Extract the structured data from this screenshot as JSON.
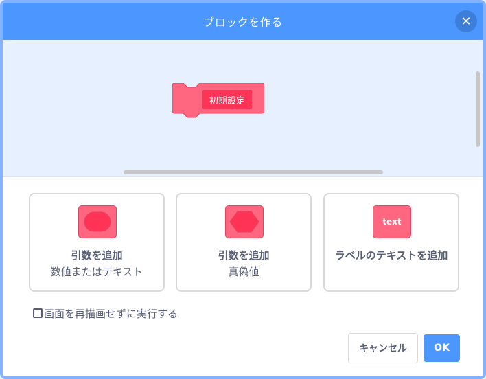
{
  "dialog": {
    "title": "ブロックを作る",
    "close_glyph": "✕"
  },
  "workspace": {
    "block_label": "初期設定",
    "block_color": "#ff6680",
    "label_bg_color": "#ff3355"
  },
  "options": [
    {
      "title": "引数を追加",
      "subtitle": "数値またはテキスト",
      "icon": "rounded-input-icon"
    },
    {
      "title": "引数を追加",
      "subtitle": "真偽値",
      "icon": "boolean-input-icon"
    },
    {
      "title": "ラベルのテキストを追加",
      "subtitle": "",
      "icon": "text-label-icon",
      "icon_text": "text"
    }
  ],
  "checkbox": {
    "label": "画面を再描画せずに実行する",
    "checked": false
  },
  "buttons": {
    "cancel": "キャンセル",
    "ok": "OK"
  },
  "colors": {
    "header": "#4c97ff",
    "workspace_bg": "#e6f0ff",
    "text": "#575e75"
  }
}
